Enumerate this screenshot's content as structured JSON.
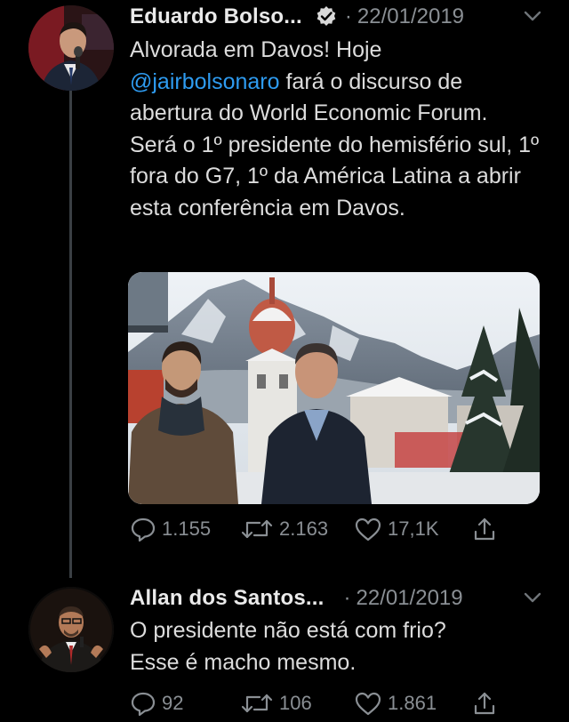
{
  "tweets": [
    {
      "author": "Eduardo Bolso...",
      "verified": true,
      "separator": "·",
      "date": "22/01/2019",
      "text_before_mention": "Alvorada em Davos! Hoje\n",
      "mention": "@jairbolsonaro",
      "text_after_mention": " fará o discurso de abertura do World Economic Forum.  Será o 1º presidente do hemisfério sul, 1º fora do G7, 1º da América Latina a abrir esta conferência em Davos.",
      "has_photo": true,
      "replies": "1.155",
      "retweets": "2.163",
      "likes": "17,1K"
    },
    {
      "author": "Allan dos Santos...",
      "verified": false,
      "separator": "·",
      "date": "22/01/2019",
      "text": "O presidente não está com frio?\nEsse é macho mesmo.",
      "has_photo": false,
      "replies": "92",
      "retweets": "106",
      "likes": "1.861"
    }
  ],
  "colors": {
    "background": "#000000",
    "text": "#dcdcdc",
    "muted": "#8a8f94",
    "mention": "#2e9bf0",
    "thread_line": "#3a3f44"
  },
  "icons": [
    "verified-badge-icon",
    "chevron-down-icon",
    "reply-icon",
    "retweet-icon",
    "like-icon",
    "share-icon"
  ]
}
